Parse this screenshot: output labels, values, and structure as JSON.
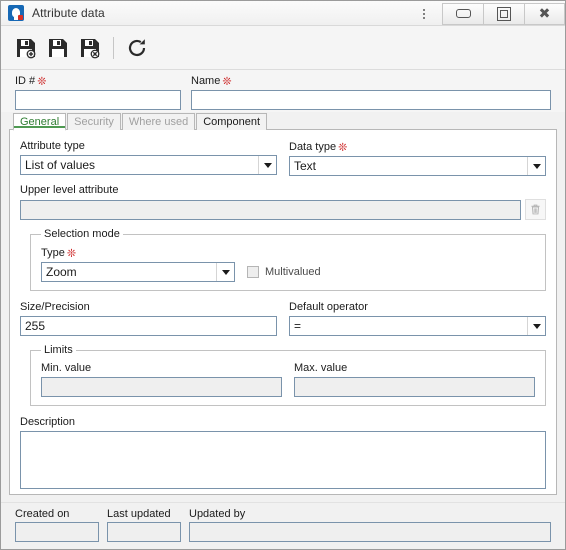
{
  "window": {
    "title": "Attribute data",
    "app_icon": "lightbulb-icon",
    "controls": {
      "menu": "kebab-menu-icon",
      "minimize": "minimize-icon",
      "restore": "restore-icon",
      "close": "close-icon"
    }
  },
  "toolbar": {
    "buttons": [
      {
        "name": "save-new-button",
        "icon": "floppy-disk-add-icon",
        "label": "Save as new"
      },
      {
        "name": "save-button",
        "icon": "floppy-disk-icon",
        "label": "Save"
      },
      {
        "name": "save-delete-button",
        "icon": "floppy-disk-delete-icon",
        "label": "Delete"
      },
      {
        "name": "refresh-button",
        "icon": "refresh-icon",
        "label": "Refresh"
      }
    ]
  },
  "header_fields": {
    "id": {
      "label": "ID #",
      "required": true,
      "value": "",
      "placeholder": ""
    },
    "name": {
      "label": "Name",
      "required": true,
      "value": "",
      "placeholder": ""
    }
  },
  "tabs": [
    {
      "label": "General",
      "state": "active"
    },
    {
      "label": "Security",
      "state": "disabled"
    },
    {
      "label": "Where used",
      "state": "disabled"
    },
    {
      "label": "Component",
      "state": "enabled"
    }
  ],
  "general": {
    "attribute_type": {
      "label": "Attribute type",
      "required": false,
      "value": "List of values",
      "options": [
        "List of values"
      ]
    },
    "data_type": {
      "label": "Data type",
      "required": true,
      "value": "Text",
      "options": [
        "Text"
      ]
    },
    "upper_level_attribute": {
      "label": "Upper level attribute",
      "value": "",
      "disabled": true,
      "clear_button": "trash-icon"
    },
    "selection_mode": {
      "legend": "Selection mode",
      "type": {
        "label": "Type",
        "required": true,
        "value": "Zoom",
        "options": [
          "Zoom"
        ]
      },
      "multivalued": {
        "label": "Multivalued",
        "checked": false,
        "disabled": true
      }
    },
    "size_precision": {
      "label": "Size/Precision",
      "value": "255"
    },
    "default_operator": {
      "label": "Default operator",
      "value": "=",
      "options": [
        "="
      ]
    },
    "limits": {
      "legend": "Limits",
      "min_value": {
        "label": "Min. value",
        "value": "",
        "disabled": true
      },
      "max_value": {
        "label": "Max. value",
        "value": "",
        "disabled": true
      }
    },
    "description": {
      "label": "Description",
      "value": ""
    }
  },
  "footer": {
    "created_on": {
      "label": "Created on",
      "value": "",
      "disabled": true
    },
    "last_updated": {
      "label": "Last updated",
      "value": "",
      "disabled": true
    },
    "updated_by": {
      "label": "Updated by",
      "value": "",
      "disabled": true
    }
  },
  "colors": {
    "active_tab_text": "#2f7d32",
    "required_marker": "#cc2222",
    "field_border": "#7a93ab",
    "window_chrome": "#f1f1f1"
  }
}
